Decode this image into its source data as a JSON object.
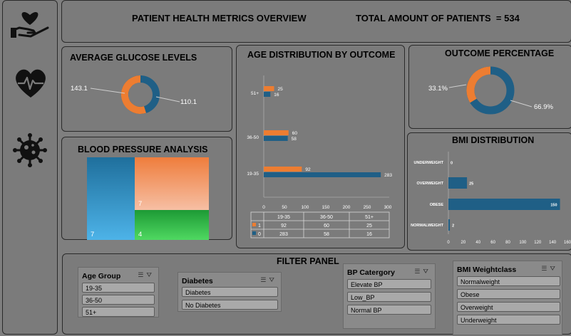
{
  "header": {
    "title": "PATIENT HEALTH METRICS OVERVIEW",
    "total_label": "TOTAL AMOUNT OF PATIENTS  = 534"
  },
  "sidebar": {
    "icons": [
      "heart-in-hand-icon",
      "heart-pulse-icon",
      "virus-icon"
    ]
  },
  "glucose": {
    "title": "AVERAGE GLUCOSE LEVELS",
    "values": [
      "143.1",
      "110.1"
    ],
    "colors": [
      "#ed7d31",
      "#1f5f86"
    ]
  },
  "bp": {
    "title": "BLOOD PRESSURE ANALYSIS",
    "labels": [
      "7",
      "7",
      "4"
    ],
    "colors": [
      "#4db3e8",
      "#f4a98a",
      "#3fcc4e"
    ]
  },
  "outcome": {
    "title": "OUTCOME PERCENTAGE",
    "values": [
      "33.1%",
      "66.9%"
    ]
  },
  "chart_data": [
    {
      "type": "bar",
      "title": "AGE DISTRIBUTION BY OUTCOME",
      "categories": [
        "51+",
        "36-50",
        "19-35"
      ],
      "series": [
        {
          "name": "1",
          "values": [
            25,
            60,
            92
          ],
          "color": "#ed7d31"
        },
        {
          "name": "0",
          "values": [
            16,
            58,
            283
          ],
          "color": "#1f5f86"
        }
      ],
      "xlim": [
        0,
        300
      ],
      "xticks": [
        "0",
        "50",
        "100",
        "150",
        "200",
        "250",
        "300"
      ],
      "table_header": [
        "19-35",
        "36-50",
        "51+"
      ],
      "table_rows": [
        {
          "name": "1",
          "values": [
            "92",
            "60",
            "25"
          ]
        },
        {
          "name": "0",
          "values": [
            "283",
            "58",
            "16"
          ]
        }
      ]
    },
    {
      "type": "bar",
      "title": "BMI DISTRIBUTION",
      "categories": [
        "UNDERWEIGHT",
        "OVERWEIGHT",
        "OBESE",
        "NORMALWEIGHT"
      ],
      "values": [
        0,
        25,
        150,
        2
      ],
      "xlim": [
        0,
        160
      ],
      "xticks": [
        "0",
        "20",
        "40",
        "60",
        "80",
        "100",
        "120",
        "140",
        "160"
      ]
    }
  ],
  "filter": {
    "title": "FILTER PANEL",
    "age": {
      "title": "Age Group",
      "items": [
        "19-35",
        "36-50",
        "51+"
      ]
    },
    "diabetes": {
      "title": "Diabetes",
      "items": [
        "Diabetes",
        "No Diabetes"
      ]
    },
    "bp_cat": {
      "title": "BP Catergory",
      "items": [
        "Elevate BP",
        "Low_BP",
        "Normal BP"
      ]
    },
    "bmi_class": {
      "title": "BMI Weightclass",
      "items": [
        "Normalweight",
        "Obese",
        "Overweight",
        "Underweight"
      ]
    }
  }
}
